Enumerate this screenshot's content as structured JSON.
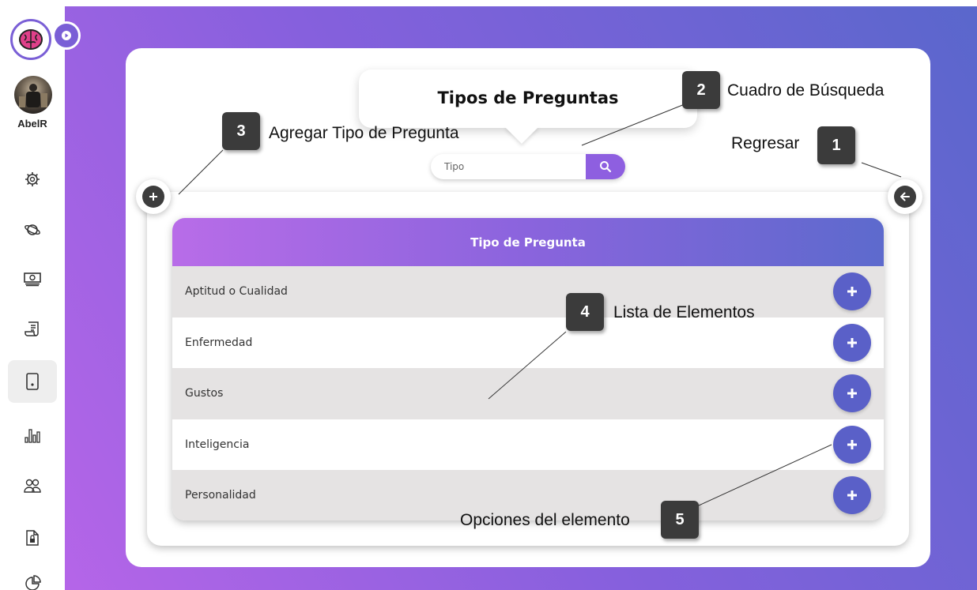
{
  "sidebar": {
    "username": "AbelR",
    "items": [
      {
        "icon": "gear-icon"
      },
      {
        "icon": "planet-icon"
      },
      {
        "icon": "money-icon"
      },
      {
        "icon": "scroll-icon"
      },
      {
        "icon": "tablet-icon",
        "active": true
      },
      {
        "icon": "bar-chart-icon"
      },
      {
        "icon": "users-icon"
      },
      {
        "icon": "document-lock-icon"
      },
      {
        "icon": "pie-chart-icon"
      }
    ]
  },
  "header": {
    "title": "Tipos de Preguntas"
  },
  "search": {
    "placeholder": "Tipo"
  },
  "table": {
    "header": "Tipo de Pregunta",
    "rows": [
      {
        "label": "Aptitud o Cualidad"
      },
      {
        "label": "Enfermedad"
      },
      {
        "label": "Gustos"
      },
      {
        "label": "Inteligencia"
      },
      {
        "label": "Personalidad"
      }
    ]
  },
  "annotations": [
    {
      "number": "1",
      "text": "Regresar"
    },
    {
      "number": "2",
      "text": "Cuadro de Búsqueda"
    },
    {
      "number": "3",
      "text": "Agregar Tipo de Pregunta"
    },
    {
      "number": "4",
      "text": "Lista de Elementos"
    },
    {
      "number": "5",
      "text": "Opciones del elemento"
    }
  ],
  "colors": {
    "accent": "#8e5fe0",
    "row_button": "#5a60c8",
    "dark_button": "#3d3d3d"
  }
}
